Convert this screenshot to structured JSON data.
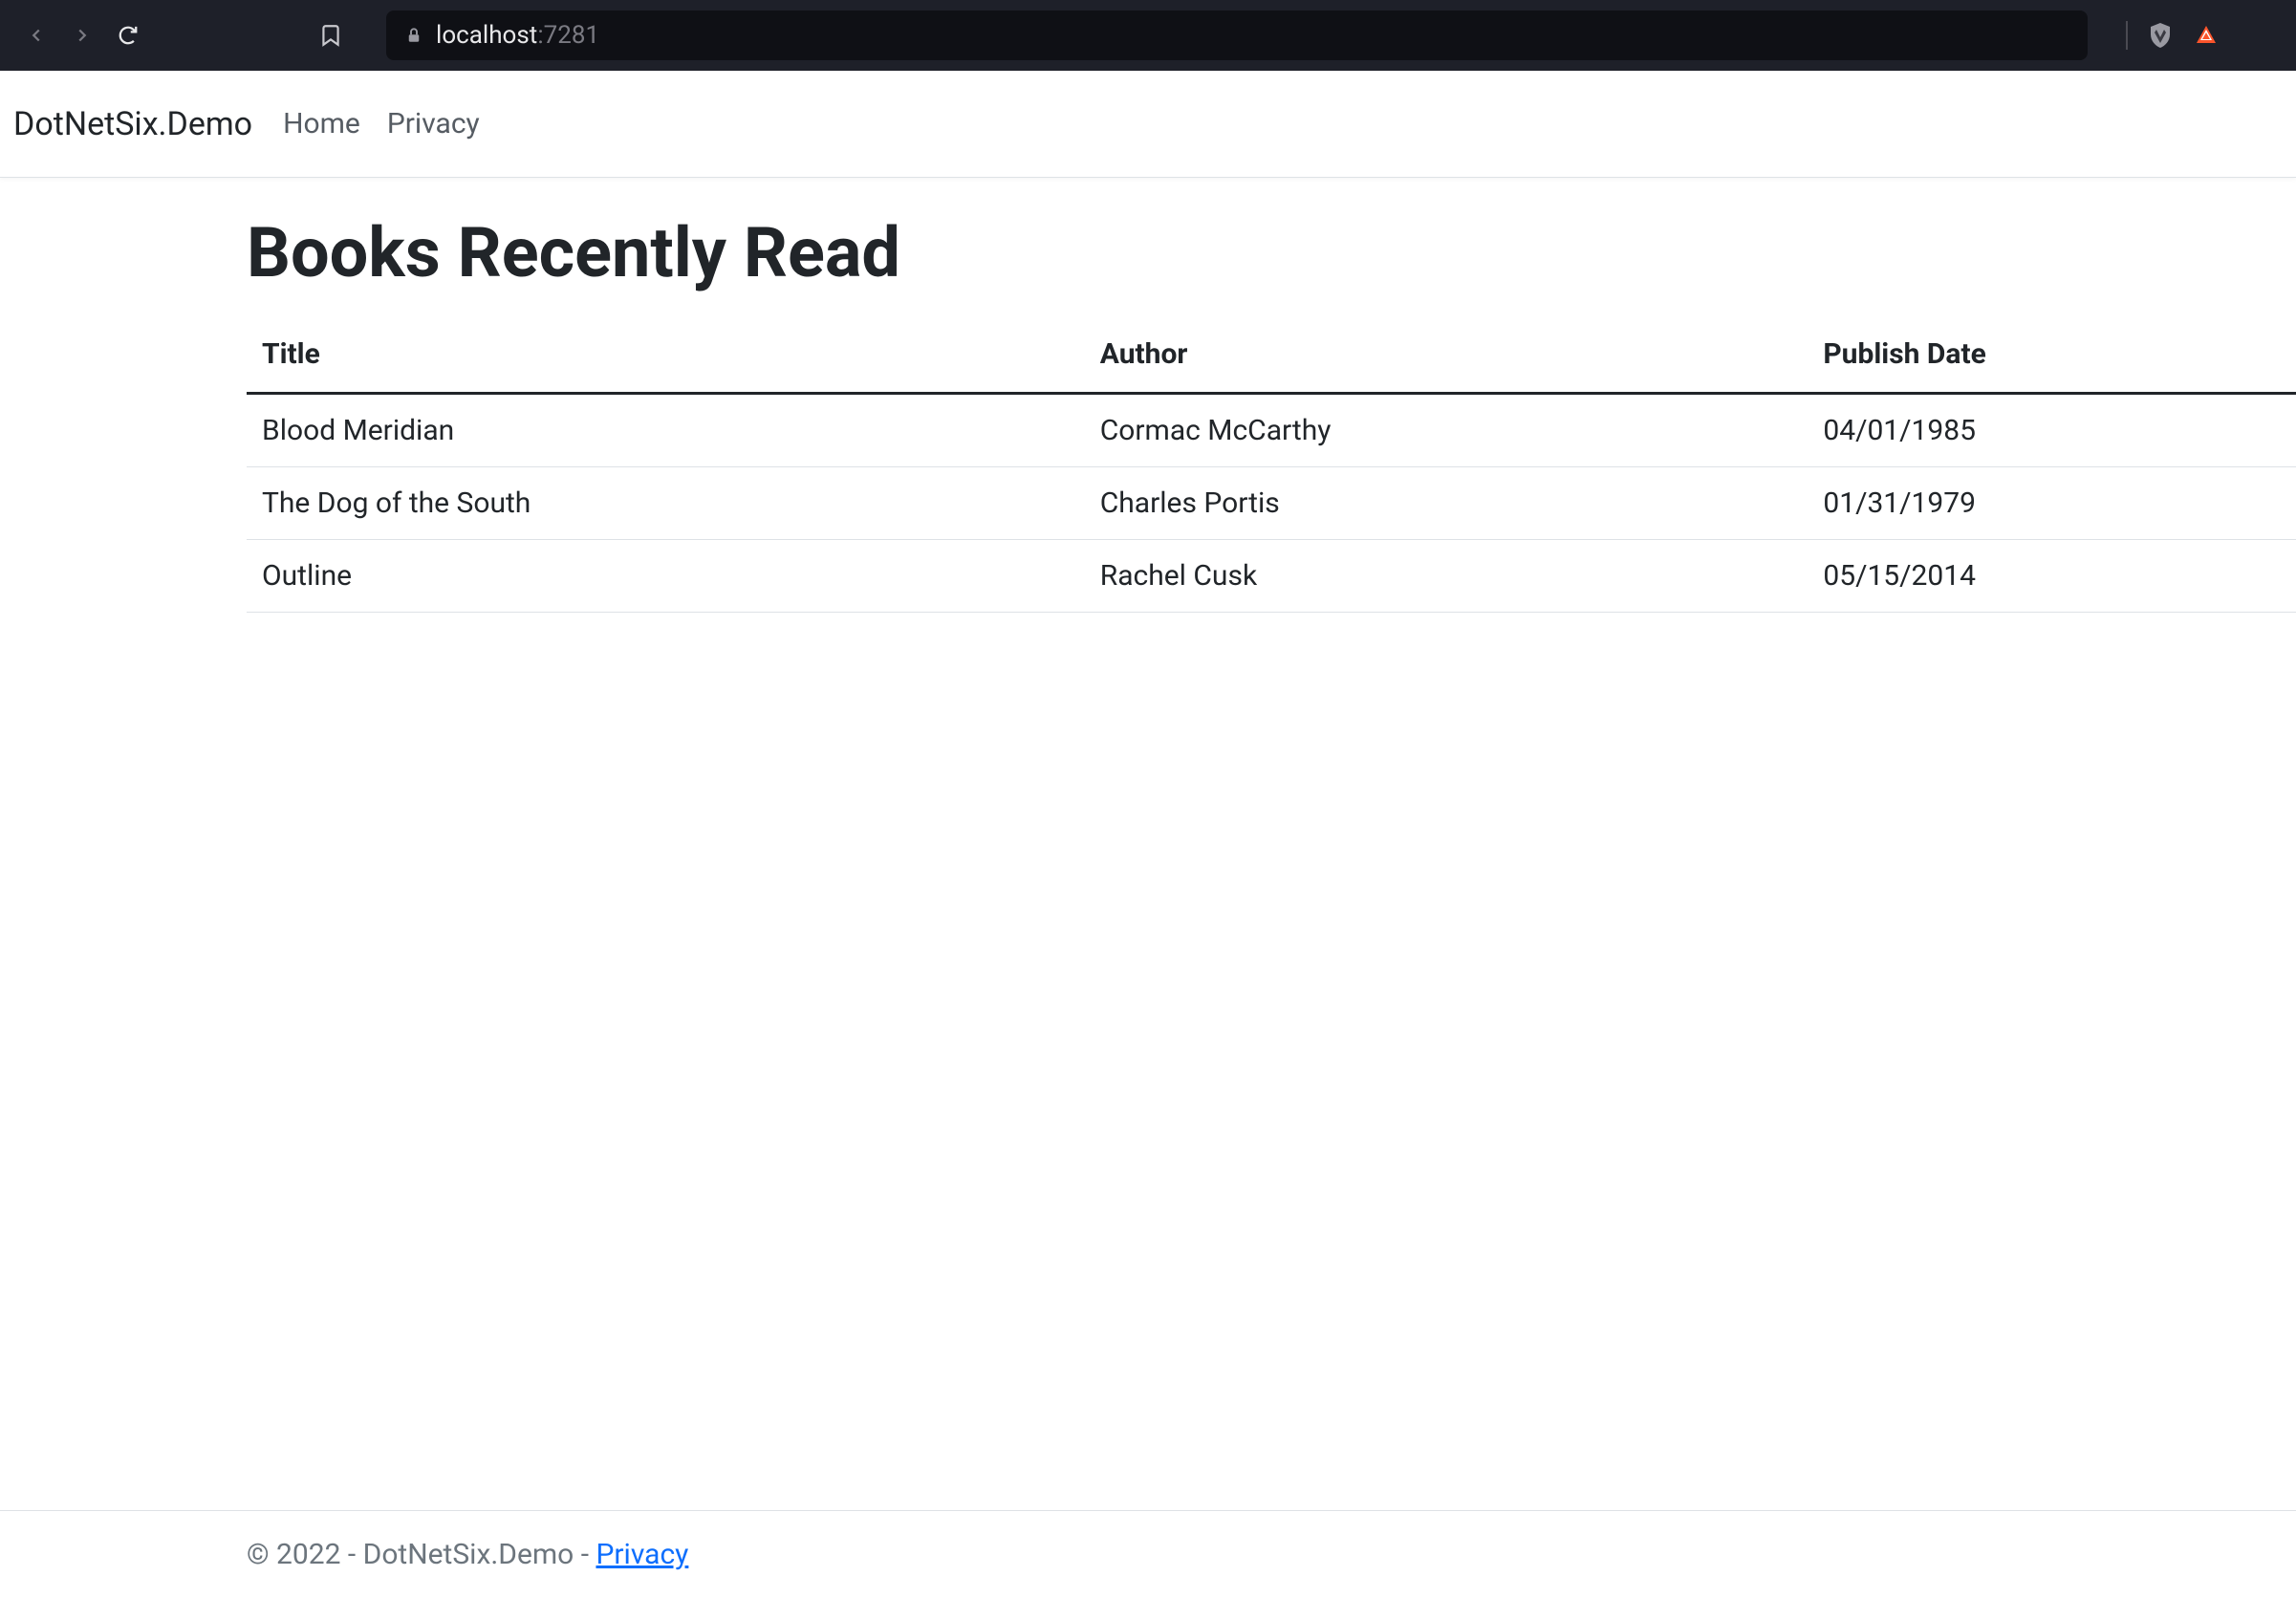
{
  "browser": {
    "url_host": "localhost",
    "url_port": ":7281"
  },
  "navbar": {
    "brand": "DotNetSix.Demo",
    "links": [
      {
        "label": "Home"
      },
      {
        "label": "Privacy"
      }
    ]
  },
  "page": {
    "title": "Books Recently Read"
  },
  "table": {
    "headers": {
      "title": "Title",
      "author": "Author",
      "publish_date": "Publish Date"
    },
    "rows": [
      {
        "title": "Blood Meridian",
        "author": "Cormac McCarthy",
        "publish_date": "04/01/1985"
      },
      {
        "title": "The Dog of the South",
        "author": "Charles Portis",
        "publish_date": "01/31/1979"
      },
      {
        "title": "Outline",
        "author": "Rachel Cusk",
        "publish_date": "05/15/2014"
      }
    ]
  },
  "footer": {
    "copyright": "© 2022 - DotNetSix.Demo - ",
    "privacy_link": "Privacy"
  }
}
